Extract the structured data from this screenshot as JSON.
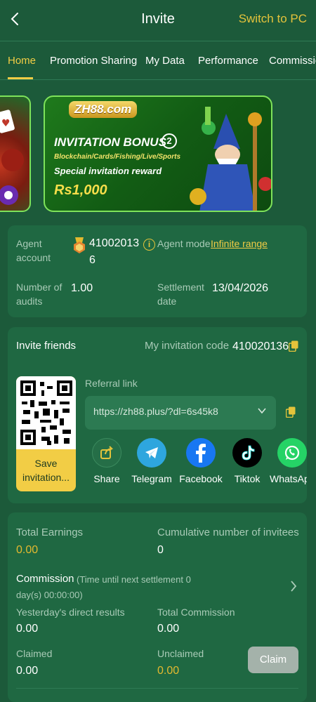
{
  "header": {
    "title": "Invite",
    "switch_label": "Switch to PC"
  },
  "tabs": [
    {
      "label": "Home",
      "active": true
    },
    {
      "label": "Promotion Sharing",
      "active": false
    },
    {
      "label": "My Data",
      "active": false
    },
    {
      "label": "Performance",
      "active": false
    },
    {
      "label": "Commission",
      "active": false
    }
  ],
  "banner": {
    "logo": "ZH88.com",
    "title": "INVITATION BONUS",
    "badge": "2",
    "subtitle": "Blockchain/Cards/Fishing/Live/Sports",
    "special": "Special invitation reward",
    "amount": "Rs1,000"
  },
  "account": {
    "agent_account_label": "Agent account",
    "agent_account_value_line1": "41002013",
    "agent_account_value_line2": "6",
    "agent_mode_label": "Agent mode",
    "agent_mode_value": "Infinite range",
    "audits_label_line1": "Number of",
    "audits_label_line2": "audits",
    "audits_value": "1.00",
    "settlement_label_line1": "Settlement",
    "settlement_label_line2": "date",
    "settlement_value": "13/04/2026"
  },
  "invite": {
    "title": "Invite friends",
    "code_label": "My invitation code",
    "code_value": "410020136",
    "save_label_line1": "Save",
    "save_label_line2": "invitation...",
    "referral_label": "Referral link",
    "referral_value": "https://zh88.plus/?dl=6s45k8",
    "share": [
      {
        "label": "Share",
        "icon": "share-icon"
      },
      {
        "label": "Telegram",
        "icon": "telegram-icon"
      },
      {
        "label": "Facebook",
        "icon": "facebook-icon"
      },
      {
        "label": "Tiktok",
        "icon": "tiktok-icon"
      },
      {
        "label": "WhatsApp",
        "icon": "whatsapp-icon"
      }
    ]
  },
  "earnings": {
    "total_earnings_label": "Total Earnings",
    "total_earnings_value": "0.00",
    "invitees_label": "Cumulative number of invitees",
    "invitees_value": "0",
    "commission_label": "Commission",
    "settle_note_line1": "(Time until next settlement  0",
    "settle_note_line2": "day(s) 00:00:00)",
    "direct_label": "Yesterday's direct results",
    "direct_value": "0.00",
    "total_commission_label": "Total Commission",
    "total_commission_value": "0.00",
    "claimed_label": "Claimed",
    "claimed_value": "0.00",
    "unclaimed_label": "Unclaimed",
    "unclaimed_value": "0.00",
    "claim_button": "Claim"
  },
  "colors": {
    "background": "#1c5a3a",
    "card": "#1f6842",
    "accent": "#f2cd45",
    "muted": "#a9cbb7"
  }
}
